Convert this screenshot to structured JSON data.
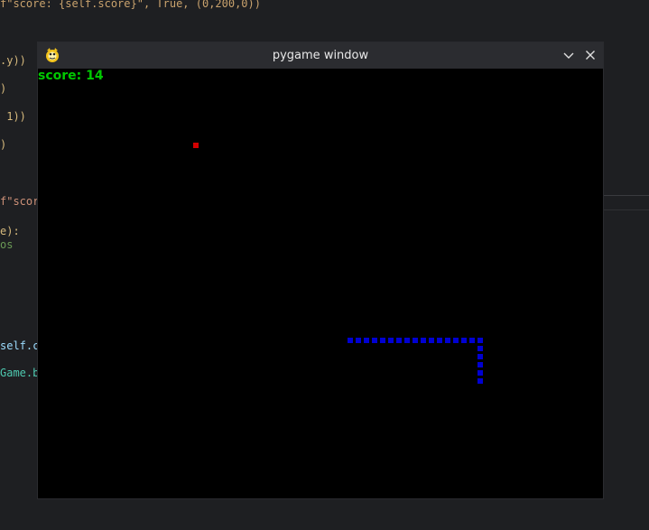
{
  "editor": {
    "lines": [
      {
        "text": "f\"score: {self.score}\", True, (0,200,0))",
        "color": "#c9a26d"
      },
      {
        "text": ".y))",
        "color": "#d7ba7d"
      },
      {
        "text": ")",
        "color": "#d7ba7d"
      },
      {
        "text": " 1))",
        "color": "#d7ba7d"
      },
      {
        "text": ")",
        "color": "#d7ba7d"
      },
      {
        "text": "f\"scor",
        "color": "#ce9178"
      },
      {
        "text": "e):",
        "color": "#d7ba7d"
      },
      {
        "text": "os",
        "color": "#6a9955"
      },
      {
        "text": "self.c",
        "color": "#9cdcfe"
      },
      {
        "text": "Game.b",
        "color": "#4ec9b0"
      }
    ]
  },
  "window": {
    "title": "pygame window",
    "minimize_icon": "chevron-down-icon",
    "close_icon": "close-icon"
  },
  "game": {
    "score_text": "score: 14",
    "score_color": "#00c800",
    "food_color": "#d20000",
    "snake_color": "#0000d2",
    "grid": {
      "cols": 69,
      "rows": 52
    },
    "food": {
      "col": 19,
      "row": 9
    },
    "snake": {
      "head": {
        "col": 54,
        "row": 38
      },
      "segments": [
        {
          "col": 38,
          "row": 33
        },
        {
          "col": 39,
          "row": 33
        },
        {
          "col": 40,
          "row": 33
        },
        {
          "col": 41,
          "row": 33
        },
        {
          "col": 42,
          "row": 33
        },
        {
          "col": 43,
          "row": 33
        },
        {
          "col": 44,
          "row": 33
        },
        {
          "col": 45,
          "row": 33
        },
        {
          "col": 46,
          "row": 33
        },
        {
          "col": 47,
          "row": 33
        },
        {
          "col": 48,
          "row": 33
        },
        {
          "col": 49,
          "row": 33
        },
        {
          "col": 50,
          "row": 33
        },
        {
          "col": 51,
          "row": 33
        },
        {
          "col": 52,
          "row": 33
        },
        {
          "col": 53,
          "row": 33
        },
        {
          "col": 54,
          "row": 33
        },
        {
          "col": 54,
          "row": 34
        },
        {
          "col": 54,
          "row": 35
        },
        {
          "col": 54,
          "row": 36
        },
        {
          "col": 54,
          "row": 37
        },
        {
          "col": 54,
          "row": 38
        }
      ]
    }
  }
}
